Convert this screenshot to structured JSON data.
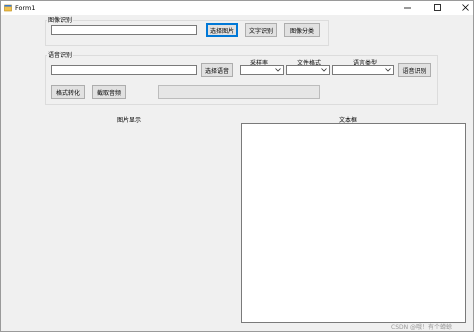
{
  "window": {
    "title": "Form1"
  },
  "image_group": {
    "label": "图像识别",
    "path_value": "",
    "buttons": {
      "select_image": "选择图片",
      "text_recognition": "文字识别",
      "image_classification": "图像分类"
    }
  },
  "speech_group": {
    "label": "语音识别",
    "path_value": "",
    "select_audio": "选择语音",
    "sample_rate_label": "采样率",
    "file_format_label": "文件格式",
    "language_type_label": "语言类型",
    "sample_rate_value": "",
    "file_format_value": "",
    "language_type_value": "",
    "recognize_button": "语音识别",
    "format_convert_button": "格式转化",
    "fetch_service_button": "截取音频"
  },
  "image_display": {
    "label": "图片显示"
  },
  "text_box": {
    "label": "文本框",
    "content": ""
  },
  "watermark": {
    "text": "CSDN @哦！有个蝉蜍"
  },
  "colors": {
    "focus_border": "#0078d7",
    "window_bg": "#f0f0f0"
  }
}
